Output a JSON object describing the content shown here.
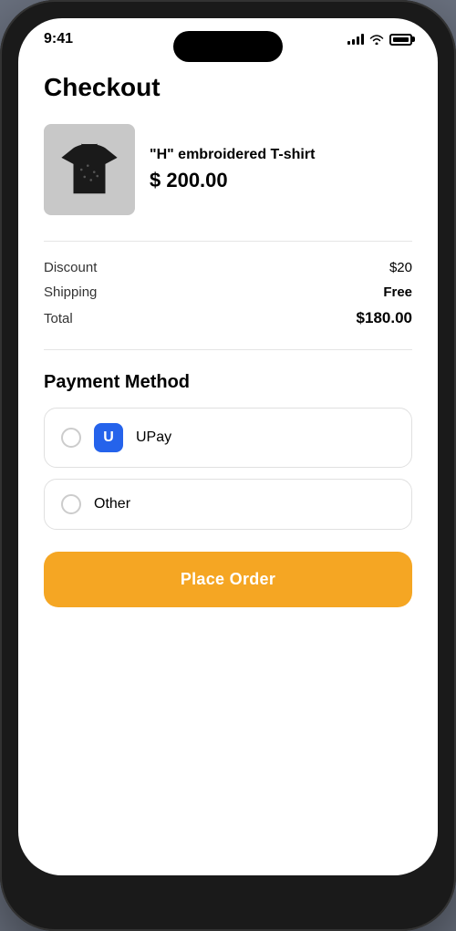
{
  "statusBar": {
    "time": "9:41"
  },
  "page": {
    "title": "Checkout"
  },
  "product": {
    "name": "\"H\" embroidered T-shirt",
    "price": "$ 200.00"
  },
  "orderSummary": {
    "discountLabel": "Discount",
    "discountValue": "$20",
    "shippingLabel": "Shipping",
    "shippingValue": "Free",
    "totalLabel": "Total",
    "totalValue": "$180.00"
  },
  "paymentSection": {
    "title": "Payment Method",
    "options": [
      {
        "id": "upay",
        "label": "UPay",
        "hasLogo": true,
        "logoText": "U",
        "selected": false
      },
      {
        "id": "other",
        "label": "Other",
        "hasLogo": false,
        "selected": false
      }
    ]
  },
  "placeOrderButton": {
    "label": "Place Order"
  }
}
